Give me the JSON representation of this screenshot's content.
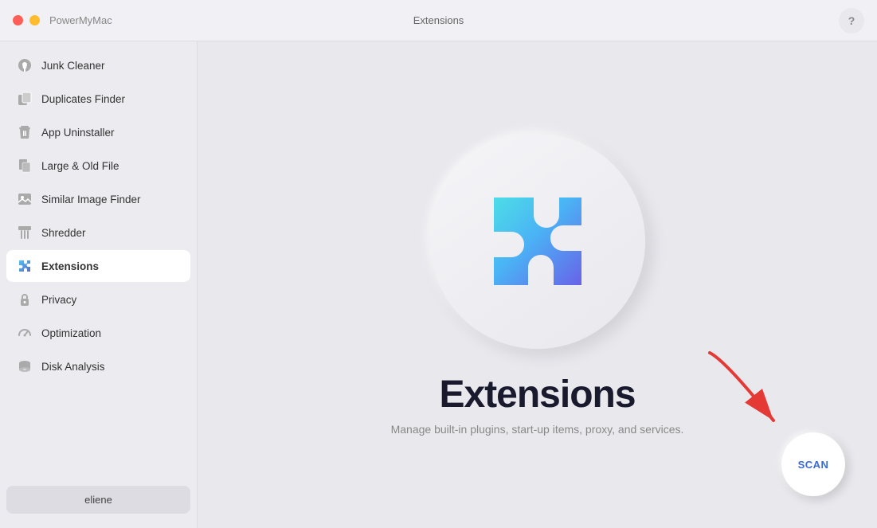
{
  "titleBar": {
    "centerTitle": "Extensions",
    "appBrand": "PowerMyMac",
    "helpLabel": "?"
  },
  "sidebar": {
    "items": [
      {
        "id": "junk-cleaner",
        "label": "Junk Cleaner",
        "icon": "broom"
      },
      {
        "id": "duplicates-finder",
        "label": "Duplicates Finder",
        "icon": "copy"
      },
      {
        "id": "app-uninstaller",
        "label": "App Uninstaller",
        "icon": "trash"
      },
      {
        "id": "large-old-file",
        "label": "Large & Old File",
        "icon": "file"
      },
      {
        "id": "similar-image-finder",
        "label": "Similar Image Finder",
        "icon": "image"
      },
      {
        "id": "shredder",
        "label": "Shredder",
        "icon": "shred"
      },
      {
        "id": "extensions",
        "label": "Extensions",
        "icon": "puzzle",
        "active": true
      },
      {
        "id": "privacy",
        "label": "Privacy",
        "icon": "lock"
      },
      {
        "id": "optimization",
        "label": "Optimization",
        "icon": "speed"
      },
      {
        "id": "disk-analysis",
        "label": "Disk Analysis",
        "icon": "disk"
      }
    ],
    "userLabel": "eliene"
  },
  "content": {
    "title": "Extensions",
    "description": "Manage built-in plugins, start-up items, proxy, and services.",
    "scanLabel": "SCAN"
  }
}
